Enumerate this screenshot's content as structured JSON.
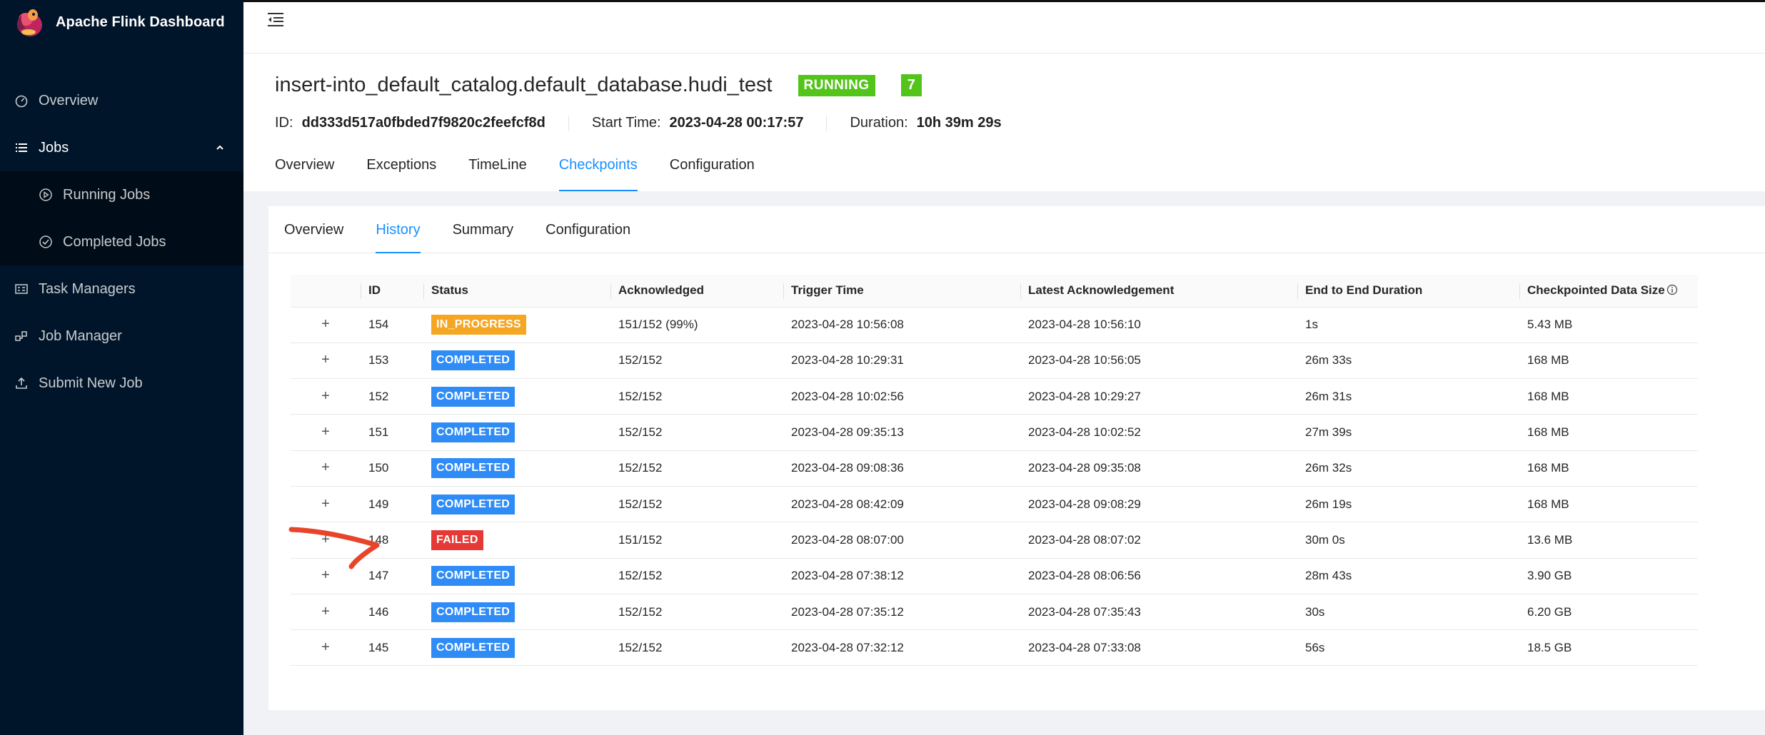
{
  "app": {
    "title": "Apache Flink Dashboard"
  },
  "sidebar": {
    "items": [
      {
        "label": "Overview",
        "icon": "dashboard-icon"
      },
      {
        "label": "Jobs",
        "icon": "list-icon"
      },
      {
        "label": "Running Jobs",
        "icon": "play-circle-icon"
      },
      {
        "label": "Completed Jobs",
        "icon": "check-circle-icon"
      },
      {
        "label": "Task Managers",
        "icon": "server-icon"
      },
      {
        "label": "Job Manager",
        "icon": "cluster-icon"
      },
      {
        "label": "Submit New Job",
        "icon": "upload-icon"
      }
    ]
  },
  "job": {
    "name": "insert-into_default_catalog.default_database.hudi_test",
    "status": "RUNNING",
    "count": "7",
    "id_label": "ID:",
    "id": "dd333d517a0fbded7f9820c2feefcf8d",
    "start_label": "Start Time:",
    "start_time": "2023-04-28 00:17:57",
    "duration_label": "Duration:",
    "duration": "10h 39m 29s"
  },
  "tabs": [
    "Overview",
    "Exceptions",
    "TimeLine",
    "Checkpoints",
    "Configuration"
  ],
  "subtabs": [
    "Overview",
    "History",
    "Summary",
    "Configuration"
  ],
  "table": {
    "headers": [
      "ID",
      "Status",
      "Acknowledged",
      "Trigger Time",
      "Latest Acknowledgement",
      "End to End Duration",
      "Checkpointed Data Size"
    ],
    "rows": [
      {
        "id": "154",
        "status": "IN_PROGRESS",
        "ack": "151/152 (99%)",
        "trigger": "2023-04-28 10:56:08",
        "latest": "2023-04-28 10:56:10",
        "duration": "1s",
        "size": "5.43 MB"
      },
      {
        "id": "153",
        "status": "COMPLETED",
        "ack": "152/152",
        "trigger": "2023-04-28 10:29:31",
        "latest": "2023-04-28 10:56:05",
        "duration": "26m 33s",
        "size": "168 MB"
      },
      {
        "id": "152",
        "status": "COMPLETED",
        "ack": "152/152",
        "trigger": "2023-04-28 10:02:56",
        "latest": "2023-04-28 10:29:27",
        "duration": "26m 31s",
        "size": "168 MB"
      },
      {
        "id": "151",
        "status": "COMPLETED",
        "ack": "152/152",
        "trigger": "2023-04-28 09:35:13",
        "latest": "2023-04-28 10:02:52",
        "duration": "27m 39s",
        "size": "168 MB"
      },
      {
        "id": "150",
        "status": "COMPLETED",
        "ack": "152/152",
        "trigger": "2023-04-28 09:08:36",
        "latest": "2023-04-28 09:35:08",
        "duration": "26m 32s",
        "size": "168 MB"
      },
      {
        "id": "149",
        "status": "COMPLETED",
        "ack": "152/152",
        "trigger": "2023-04-28 08:42:09",
        "latest": "2023-04-28 09:08:29",
        "duration": "26m 19s",
        "size": "168 MB"
      },
      {
        "id": "148",
        "status": "FAILED",
        "ack": "151/152",
        "trigger": "2023-04-28 08:07:00",
        "latest": "2023-04-28 08:07:02",
        "duration": "30m 0s",
        "size": "13.6 MB"
      },
      {
        "id": "147",
        "status": "COMPLETED",
        "ack": "152/152",
        "trigger": "2023-04-28 07:38:12",
        "latest": "2023-04-28 08:06:56",
        "duration": "28m 43s",
        "size": "3.90 GB"
      },
      {
        "id": "146",
        "status": "COMPLETED",
        "ack": "152/152",
        "trigger": "2023-04-28 07:35:12",
        "latest": "2023-04-28 07:35:43",
        "duration": "30s",
        "size": "6.20 GB"
      },
      {
        "id": "145",
        "status": "COMPLETED",
        "ack": "152/152",
        "trigger": "2023-04-28 07:32:12",
        "latest": "2023-04-28 07:33:08",
        "duration": "56s",
        "size": "18.5 GB"
      }
    ]
  },
  "colors": {
    "sidebar_bg": "#001529",
    "accent": "#1890ff",
    "running": "#52c41a",
    "in_progress": "#f5a623",
    "completed": "#2f8cf6",
    "failed": "#e53935",
    "annotation": "#e8442a"
  }
}
